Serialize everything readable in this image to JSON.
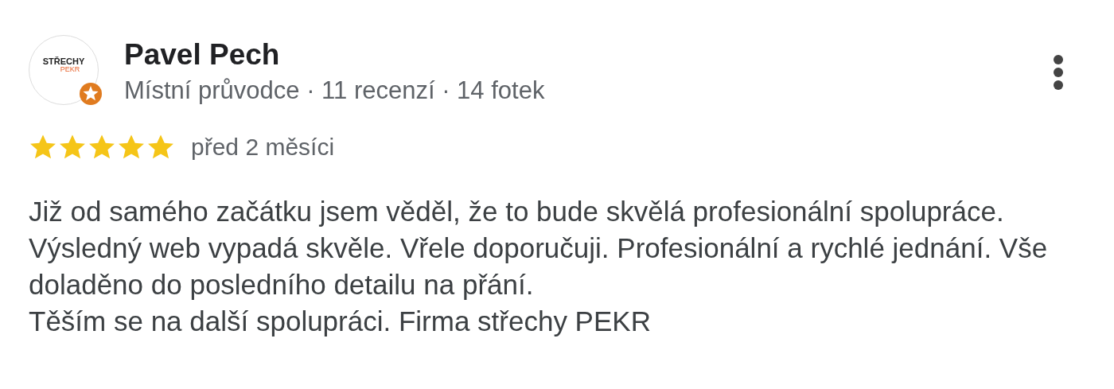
{
  "reviewer": {
    "name": "Pavel Pech",
    "avatar_logo": [
      "STŘECHY",
      "PEKR"
    ],
    "meta": "Místní průvodce · 11 recenzí · 14 fotek"
  },
  "review": {
    "stars": 5,
    "time": "před 2 měsíci",
    "paragraphs": [
      "Již od samého začátku jsem věděl, že to bude skvělá profesionální spolupráce. Výsledný web vypadá skvěle. Vřele doporučuji. Profesionální a rychlé jednání. Vše doladěno do posledního detailu na přání.",
      "Těším se na další spolupráci. Firma střechy PEKR"
    ]
  }
}
